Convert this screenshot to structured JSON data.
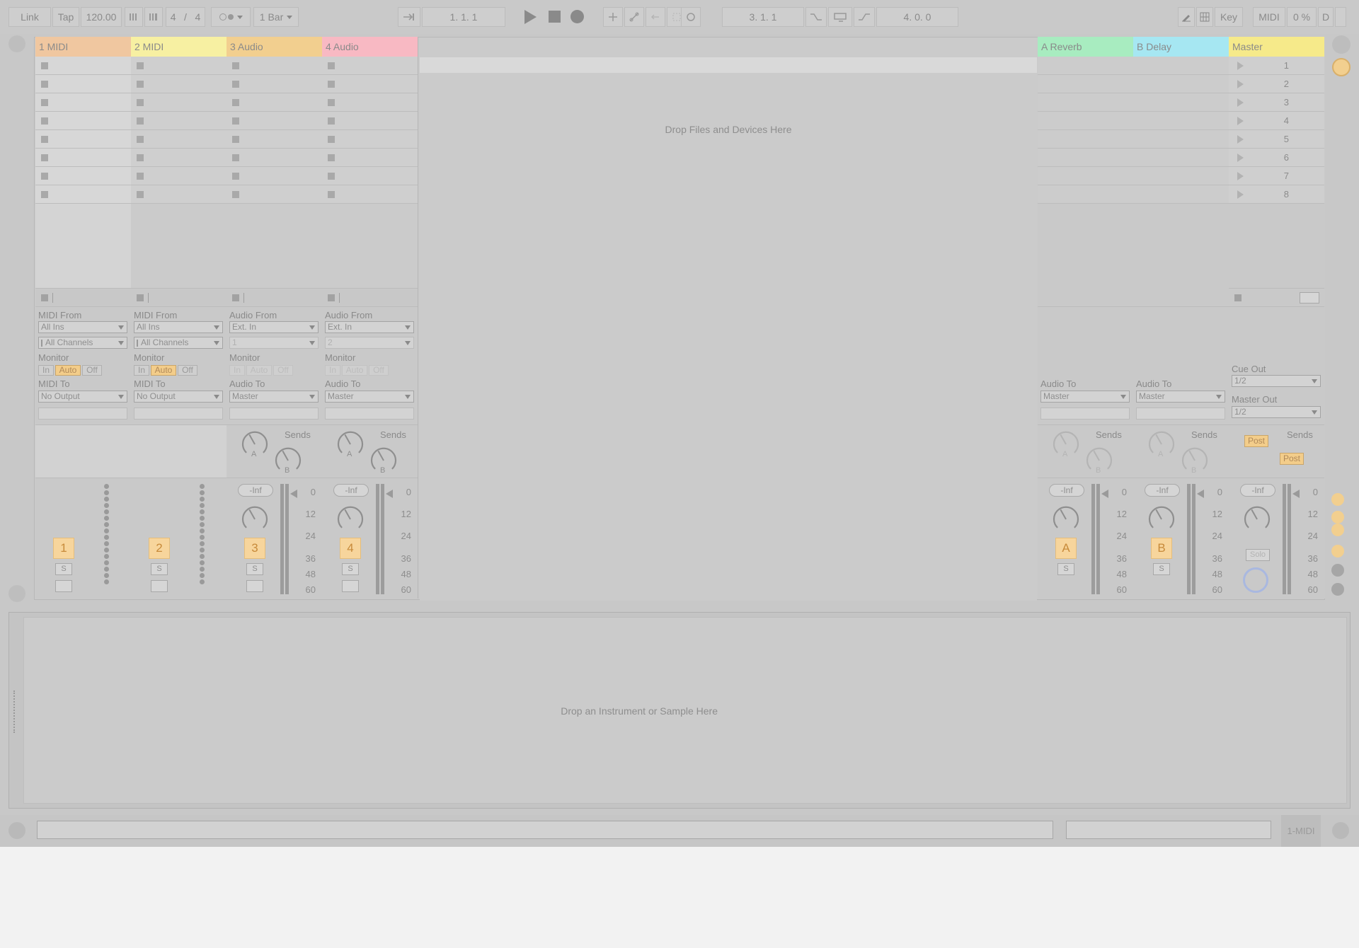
{
  "toolbar": {
    "link": "Link",
    "tap": "Tap",
    "tempo": "120.00",
    "signature_num": "4",
    "signature_sep": "/",
    "signature_den": "4",
    "quantize": "1 Bar",
    "arrangement_position": "1.   1.   1",
    "loop_start": "3.   1.   1",
    "loop_length": "4.   0.   0",
    "key": "Key",
    "midi": "MIDI",
    "cpu": "0 %",
    "d": "D"
  },
  "tracks": [
    {
      "name": "1 MIDI",
      "color": "#f0c7a0",
      "type": "midi",
      "input_label": "MIDI From",
      "input": "All Ins",
      "channel": "All Channels",
      "output_label": "MIDI To",
      "output": "No Output",
      "number": "1"
    },
    {
      "name": "2 MIDI",
      "color": "#f7f0a2",
      "type": "midi",
      "input_label": "MIDI From",
      "input": "All Ins",
      "channel": "All Channels",
      "output_label": "MIDI To",
      "output": "No Output",
      "number": "2"
    },
    {
      "name": "3 Audio",
      "color": "#f2cf8f",
      "type": "audio",
      "input_label": "Audio From",
      "input": "Ext. In",
      "channel": "1",
      "output_label": "Audio To",
      "output": "Master",
      "number": "3"
    },
    {
      "name": "4 Audio",
      "color": "#f8b9c3",
      "type": "audio",
      "input_label": "Audio From",
      "input": "Ext. In",
      "channel": "2",
      "output_label": "Audio To",
      "output": "Master",
      "number": "4"
    }
  ],
  "returns": [
    {
      "name": "A Reverb",
      "color": "#a8ecc0",
      "output_label": "Audio To",
      "output": "Master",
      "letter": "A"
    },
    {
      "name": "B Delay",
      "color": "#a6e7f2",
      "output_label": "Audio To",
      "output": "Master",
      "letter": "B"
    }
  ],
  "master": {
    "name": "Master",
    "color": "#f6ea8a",
    "scenes": [
      "1",
      "2",
      "3",
      "4",
      "5",
      "6",
      "7",
      "8"
    ],
    "cue_out_label": "Cue Out",
    "cue_out": "1/2",
    "master_out_label": "Master Out",
    "master_out": "1/2",
    "post1": "Post",
    "post2": "Post",
    "solo": "Solo"
  },
  "mixer": {
    "monitor_label": "Monitor",
    "mon_in": "In",
    "mon_auto": "Auto",
    "mon_off": "Off",
    "sends": "Sends",
    "send_a": "A",
    "send_b": "B",
    "volume": "-Inf",
    "solo_short": "S",
    "scale": [
      "0",
      "12",
      "24",
      "36",
      "48",
      "60"
    ]
  },
  "drop_files": "Drop Files and Devices Here",
  "drop_instrument": "Drop an Instrument or Sample Here",
  "status_right": "1-MIDI"
}
